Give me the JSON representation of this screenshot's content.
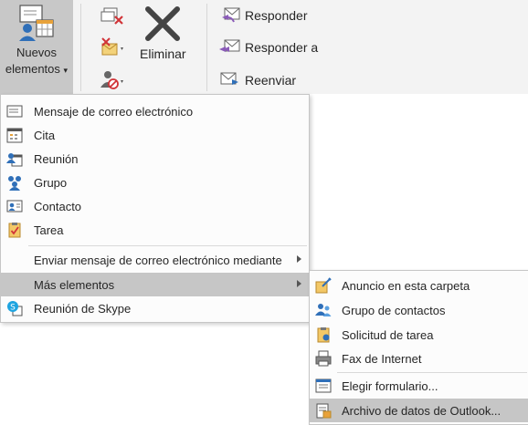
{
  "ribbon": {
    "new_items_line1": "Nuevos",
    "new_items_line2": "elementos",
    "delete_label": "Eliminar",
    "respond": [
      {
        "label": "Responder"
      },
      {
        "label": "Responder a"
      },
      {
        "label": "Reenviar"
      }
    ]
  },
  "main_menu": {
    "items": [
      {
        "label": "Mensaje de correo electrónico",
        "icon": "email-icon"
      },
      {
        "label": "Cita",
        "icon": "calendar-icon"
      },
      {
        "label": "Reunión",
        "icon": "meeting-icon"
      },
      {
        "label": "Grupo",
        "icon": "group-icon"
      },
      {
        "label": "Contacto",
        "icon": "contact-card-icon"
      },
      {
        "label": "Tarea",
        "icon": "task-clipboard-icon"
      },
      {
        "label": "Enviar mensaje de correo electrónico mediante",
        "icon": ""
      },
      {
        "label": "Más elementos",
        "icon": ""
      },
      {
        "label": "Reunión de Skype",
        "icon": "skype-meeting-icon"
      }
    ]
  },
  "sub_menu": {
    "items": [
      {
        "label": "Anuncio en esta carpeta",
        "icon": "post-note-icon"
      },
      {
        "label": "Grupo de contactos",
        "icon": "contact-group-icon"
      },
      {
        "label": "Solicitud de tarea",
        "icon": "task-request-icon"
      },
      {
        "label": "Fax de Internet",
        "icon": "fax-icon"
      },
      {
        "label": "Elegir formulario...",
        "icon": "form-icon"
      },
      {
        "label": "Archivo de datos de Outlook...",
        "icon": "data-file-icon"
      }
    ]
  },
  "colors": {
    "highlight": "#c6c6c6",
    "ribbon": "#f3f3f3",
    "blue": "#2f6fb8",
    "orange": "#e8a23a",
    "red": "#d13438"
  }
}
